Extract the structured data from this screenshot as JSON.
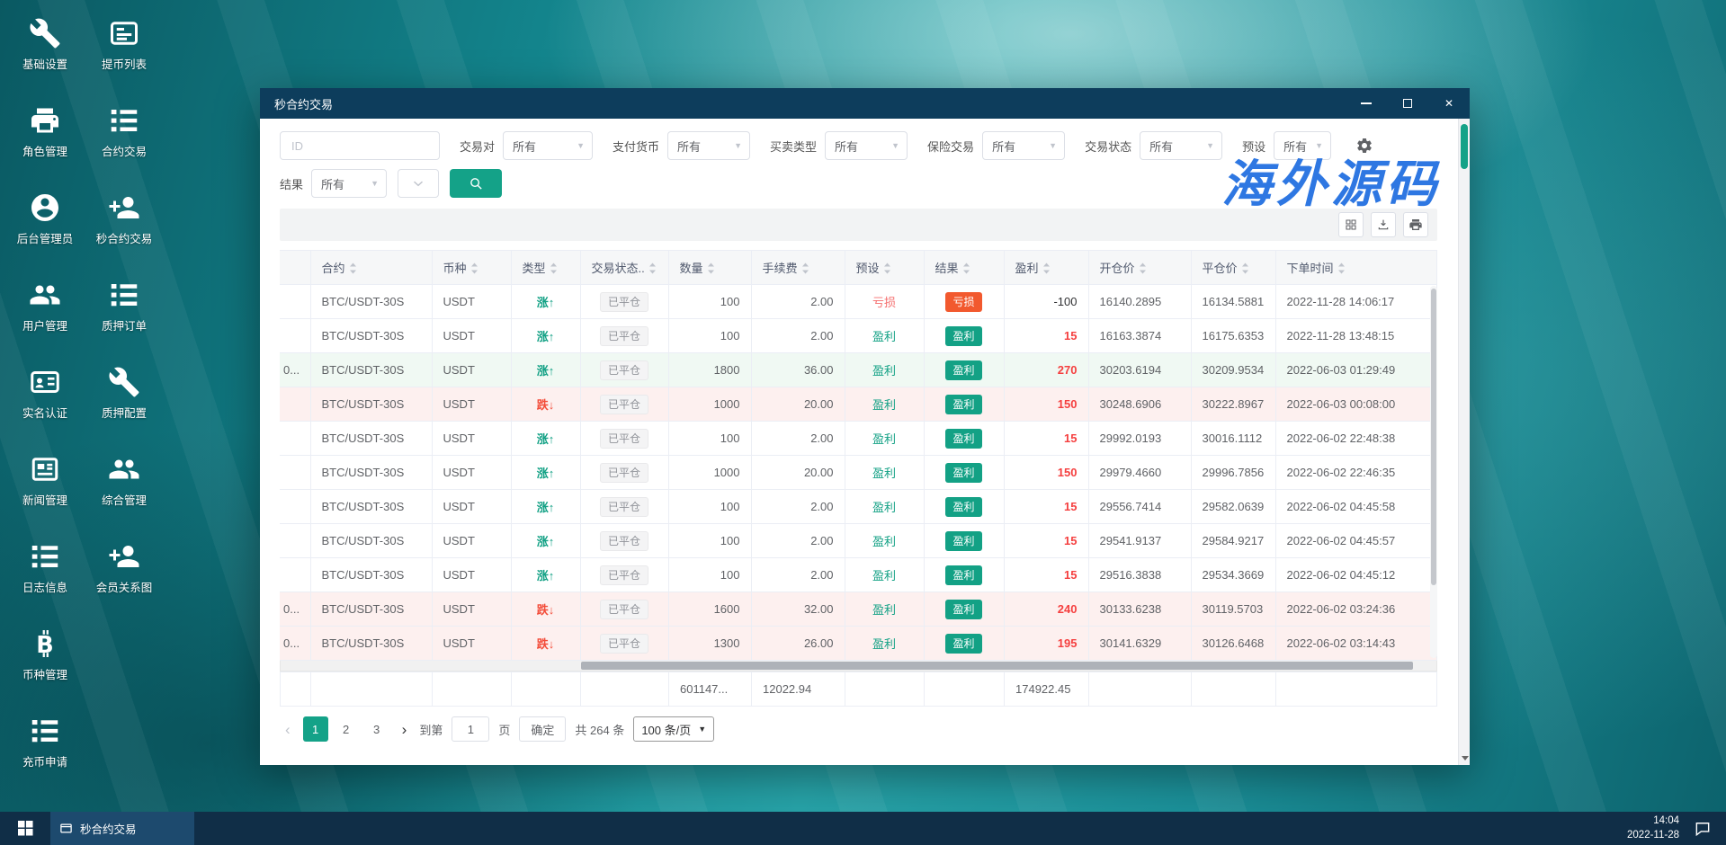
{
  "desktop": {
    "shortcuts": [
      {
        "label": "基础设置",
        "icon": "wrench-icon"
      },
      {
        "label": "角色管理",
        "icon": "printer-icon"
      },
      {
        "label": "后台管理员",
        "icon": "user-circle-icon"
      },
      {
        "label": "用户管理",
        "icon": "users-icon"
      },
      {
        "label": "实名认证",
        "icon": "id-card-icon"
      },
      {
        "label": "新闻管理",
        "icon": "newspaper-icon"
      },
      {
        "label": "日志信息",
        "icon": "list-icon"
      },
      {
        "label": "币种管理",
        "icon": "bitcoin-icon"
      },
      {
        "label": "充币申请",
        "icon": "list-icon"
      },
      {
        "label": "提币列表",
        "icon": "card-icon"
      },
      {
        "label": "合约交易",
        "icon": "list-icon"
      },
      {
        "label": "秒合约交易",
        "icon": "user-plus-icon"
      },
      {
        "label": "质押订单",
        "icon": "list-icon"
      },
      {
        "label": "质押配置",
        "icon": "wrench-icon"
      },
      {
        "label": "综合管理",
        "icon": "users-icon"
      },
      {
        "label": "会员关系图",
        "icon": "user-plus-icon"
      }
    ],
    "watermark": "海外源码"
  },
  "window": {
    "title": "秒合约交易"
  },
  "filters": {
    "id_placeholder": "ID",
    "fields": [
      {
        "label": "交易对",
        "value": "所有"
      },
      {
        "label": "支付货币",
        "value": "所有"
      },
      {
        "label": "买卖类型",
        "value": "所有"
      },
      {
        "label": "保险交易",
        "value": "所有"
      },
      {
        "label": "交易状态",
        "value": "所有"
      },
      {
        "label": "预设",
        "value": "所有"
      }
    ],
    "result_label": "结果",
    "result_value": "所有"
  },
  "table": {
    "columns": [
      "",
      "合约",
      "币种",
      "类型",
      "交易状态..",
      "数量",
      "手续费",
      "预设",
      "结果",
      "盈利",
      "开仓价",
      "平仓价",
      "下单时间"
    ],
    "rows": [
      {
        "lead": "",
        "contract": "BTC/USDT-30S",
        "coin": "USDT",
        "type": "涨↑",
        "dir": "up",
        "status": "已平仓",
        "qty": "100",
        "fee": "2.00",
        "preset": "亏损",
        "preset_type": "loss",
        "result": "亏损",
        "result_type": "loss",
        "profit": "-100",
        "profit_style": "dark",
        "open": "16140.2895",
        "close": "16134.5881",
        "time": "2022-11-28 14:06:17",
        "bg": "plain"
      },
      {
        "lead": "",
        "contract": "BTC/USDT-30S",
        "coin": "USDT",
        "type": "涨↑",
        "dir": "up",
        "status": "已平仓",
        "qty": "100",
        "fee": "2.00",
        "preset": "盈利",
        "preset_type": "win",
        "result": "盈利",
        "result_type": "win",
        "profit": "15",
        "profit_style": "red",
        "open": "16163.3874",
        "close": "16175.6353",
        "time": "2022-11-28 13:48:15",
        "bg": "plain"
      },
      {
        "lead": "0...",
        "contract": "BTC/USDT-30S",
        "coin": "USDT",
        "type": "涨↑",
        "dir": "up",
        "status": "已平仓",
        "qty": "1800",
        "fee": "36.00",
        "preset": "盈利",
        "preset_type": "win",
        "result": "盈利",
        "result_type": "win",
        "profit": "270",
        "profit_style": "red",
        "open": "30203.6194",
        "close": "30209.9534",
        "time": "2022-06-03 01:29:49",
        "bg": "green"
      },
      {
        "lead": "",
        "contract": "BTC/USDT-30S",
        "coin": "USDT",
        "type": "跌↓",
        "dir": "down",
        "status": "已平仓",
        "qty": "1000",
        "fee": "20.00",
        "preset": "盈利",
        "preset_type": "win",
        "result": "盈利",
        "result_type": "win",
        "profit": "150",
        "profit_style": "red",
        "open": "30248.6906",
        "close": "30222.8967",
        "time": "2022-06-03 00:08:00",
        "bg": "pink"
      },
      {
        "lead": "",
        "contract": "BTC/USDT-30S",
        "coin": "USDT",
        "type": "涨↑",
        "dir": "up",
        "status": "已平仓",
        "qty": "100",
        "fee": "2.00",
        "preset": "盈利",
        "preset_type": "win",
        "result": "盈利",
        "result_type": "win",
        "profit": "15",
        "profit_style": "red",
        "open": "29992.0193",
        "close": "30016.1112",
        "time": "2022-06-02 22:48:38",
        "bg": "plain"
      },
      {
        "lead": "",
        "contract": "BTC/USDT-30S",
        "coin": "USDT",
        "type": "涨↑",
        "dir": "up",
        "status": "已平仓",
        "qty": "1000",
        "fee": "20.00",
        "preset": "盈利",
        "preset_type": "win",
        "result": "盈利",
        "result_type": "win",
        "profit": "150",
        "profit_style": "red",
        "open": "29979.4660",
        "close": "29996.7856",
        "time": "2022-06-02 22:46:35",
        "bg": "plain"
      },
      {
        "lead": "",
        "contract": "BTC/USDT-30S",
        "coin": "USDT",
        "type": "涨↑",
        "dir": "up",
        "status": "已平仓",
        "qty": "100",
        "fee": "2.00",
        "preset": "盈利",
        "preset_type": "win",
        "result": "盈利",
        "result_type": "win",
        "profit": "15",
        "profit_style": "red",
        "open": "29556.7414",
        "close": "29582.0639",
        "time": "2022-06-02 04:45:58",
        "bg": "plain"
      },
      {
        "lead": "",
        "contract": "BTC/USDT-30S",
        "coin": "USDT",
        "type": "涨↑",
        "dir": "up",
        "status": "已平仓",
        "qty": "100",
        "fee": "2.00",
        "preset": "盈利",
        "preset_type": "win",
        "result": "盈利",
        "result_type": "win",
        "profit": "15",
        "profit_style": "red",
        "open": "29541.9137",
        "close": "29584.9217",
        "time": "2022-06-02 04:45:57",
        "bg": "plain"
      },
      {
        "lead": "",
        "contract": "BTC/USDT-30S",
        "coin": "USDT",
        "type": "涨↑",
        "dir": "up",
        "status": "已平仓",
        "qty": "100",
        "fee": "2.00",
        "preset": "盈利",
        "preset_type": "win",
        "result": "盈利",
        "result_type": "win",
        "profit": "15",
        "profit_style": "red",
        "open": "29516.3838",
        "close": "29534.3669",
        "time": "2022-06-02 04:45:12",
        "bg": "plain"
      },
      {
        "lead": "0...",
        "contract": "BTC/USDT-30S",
        "coin": "USDT",
        "type": "跌↓",
        "dir": "down",
        "status": "已平仓",
        "qty": "1600",
        "fee": "32.00",
        "preset": "盈利",
        "preset_type": "win",
        "result": "盈利",
        "result_type": "win",
        "profit": "240",
        "profit_style": "red",
        "open": "30133.6238",
        "close": "30119.5703",
        "time": "2022-06-02 03:24:36",
        "bg": "pink"
      },
      {
        "lead": "0...",
        "contract": "BTC/USDT-30S",
        "coin": "USDT",
        "type": "跌↓",
        "dir": "down",
        "status": "已平仓",
        "qty": "1300",
        "fee": "26.00",
        "preset": "盈利",
        "preset_type": "win",
        "result": "盈利",
        "result_type": "win",
        "profit": "195",
        "profit_style": "red",
        "open": "30141.6329",
        "close": "30126.6468",
        "time": "2022-06-02 03:14:43",
        "bg": "pink"
      }
    ],
    "summary": {
      "qty_total": "601147...",
      "fee_total": "12022.94",
      "profit_total": "174922.45"
    }
  },
  "pagination": {
    "pages": [
      "1",
      "2",
      "3"
    ],
    "active_page": "1",
    "jump_label": "到第",
    "jump_value": "1",
    "jump_unit": "页",
    "confirm_label": "确定",
    "total_label": "共 264 条",
    "page_size": "100 条/页"
  },
  "taskbar": {
    "app": "秒合约交易",
    "time": "14:04",
    "date": "2022-11-28"
  },
  "colors": {
    "accent": "#14a288",
    "profit_green": "#13a185",
    "loss_orange": "#f2592e",
    "profit_red": "#f53f3f",
    "down_red": "#f34d3a",
    "titlebar": "#0d3d5c",
    "watermark": "#1f6de0"
  }
}
